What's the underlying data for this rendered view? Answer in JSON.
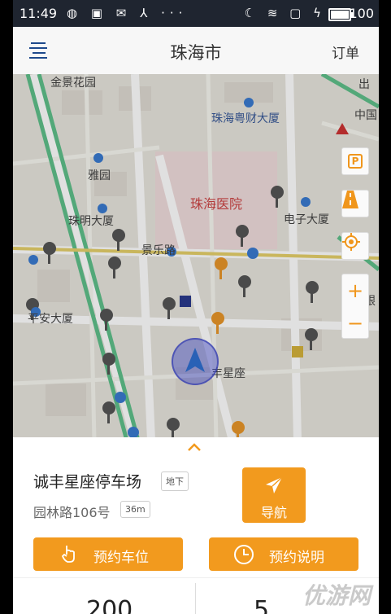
{
  "status_bar": {
    "time": "11:49",
    "left_icons": "◍ ▣ ✉ ⅄ ···",
    "right_icons": "☾ ≋ ▢ ϟ",
    "battery_level": "100"
  },
  "header": {
    "title": "珠海市",
    "orders_label": "订单"
  },
  "map": {
    "labels": {
      "jinjing": "金景花园",
      "yuecai": "珠海粤财大厦",
      "yayuan": "雅园",
      "hospital": "珠海医院",
      "zhuming": "珠明大厦",
      "dianzi": "电子大厦",
      "jingle": "景乐路",
      "pingan": "平安大厦",
      "fengxing": "丰星座",
      "zhongguo": "中国",
      "chu": "出",
      "zhong": "中",
      "yin": "银"
    },
    "controls": {
      "parking": "P",
      "zoom_in": "+",
      "zoom_out": "−"
    }
  },
  "parking": {
    "name": "诚丰星座停车场",
    "type_tag": "地下",
    "address": "园林路106号",
    "distance": "36m",
    "navigate_label": "导航",
    "reserve_label": "预约车位",
    "reserve_info_label": "预约说明",
    "price_partial": "200",
    "spots_partial": "5"
  },
  "watermark": "优游网",
  "colors": {
    "accent": "#f29a1e",
    "status_bar": "#1f2530",
    "location": "#4650dc"
  }
}
